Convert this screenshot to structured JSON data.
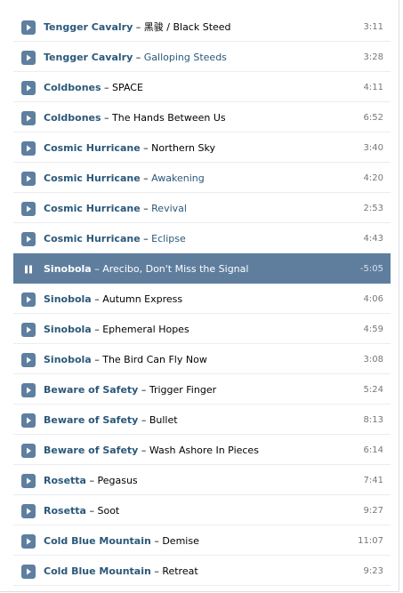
{
  "colors": {
    "accent": "#5e7f9f",
    "artist_link": "#2b587a",
    "playing_row": "#5f7e9e",
    "row_divider": "#e9edf1"
  },
  "tracks": [
    {
      "artist": "Tengger Cavalry",
      "separator": "–",
      "title": "黑骏 / Black Steed",
      "duration": "3:11",
      "state": "play-icon"
    },
    {
      "artist": "Tengger Cavalry",
      "separator": "–",
      "title": "Galloping Steeds",
      "duration": "3:28",
      "state": "play-icon"
    },
    {
      "artist": "Coldbones",
      "separator": "–",
      "title": "SPACE",
      "duration": "4:11",
      "state": "play-icon"
    },
    {
      "artist": "Coldbones",
      "separator": "–",
      "title": "The Hands Between Us",
      "duration": "6:52",
      "state": "play-icon"
    },
    {
      "artist": "Cosmic Hurricane",
      "separator": "–",
      "title": "Northern Sky",
      "duration": "3:40",
      "state": "play-icon"
    },
    {
      "artist": "Cosmic Hurricane",
      "separator": "–",
      "title": "Awakening",
      "duration": "4:20",
      "state": "play-icon"
    },
    {
      "artist": "Cosmic Hurricane",
      "separator": "–",
      "title": "Revival",
      "duration": "2:53",
      "state": "play-icon"
    },
    {
      "artist": "Cosmic Hurricane",
      "separator": "–",
      "title": "Eclipse",
      "duration": "4:43",
      "state": "play-icon"
    },
    {
      "artist": "Sinobola",
      "separator": "–",
      "title": "Arecibo, Don't Miss the Signal",
      "duration": "-5:05",
      "state": "pause-icon"
    },
    {
      "artist": "Sinobola",
      "separator": "–",
      "title": "Autumn Express",
      "duration": "4:06",
      "state": "play-icon"
    },
    {
      "artist": "Sinobola",
      "separator": "–",
      "title": "Ephemeral Hopes",
      "duration": "4:59",
      "state": "play-icon"
    },
    {
      "artist": "Sinobola",
      "separator": "–",
      "title": "The Bird Can Fly Now",
      "duration": "3:08",
      "state": "play-icon"
    },
    {
      "artist": "Beware of Safety",
      "separator": "–",
      "title": "Trigger Finger",
      "duration": "5:24",
      "state": "play-icon"
    },
    {
      "artist": "Beware of Safety",
      "separator": "–",
      "title": "Bullet",
      "duration": "8:13",
      "state": "play-icon"
    },
    {
      "artist": "Beware of Safety",
      "separator": "–",
      "title": "Wash Ashore In Pieces",
      "duration": "6:14",
      "state": "play-icon"
    },
    {
      "artist": "Rosetta",
      "separator": "–",
      "title": "Pegasus",
      "duration": "7:41",
      "state": "play-icon"
    },
    {
      "artist": "Rosetta",
      "separator": "–",
      "title": "Soot",
      "duration": "9:27",
      "state": "play-icon"
    },
    {
      "artist": "Cold Blue Mountain",
      "separator": "–",
      "title": "Demise",
      "duration": "11:07",
      "state": "play-icon"
    },
    {
      "artist": "Cold Blue Mountain",
      "separator": "–",
      "title": "Retreat",
      "duration": "9:23",
      "state": "play-icon"
    }
  ]
}
